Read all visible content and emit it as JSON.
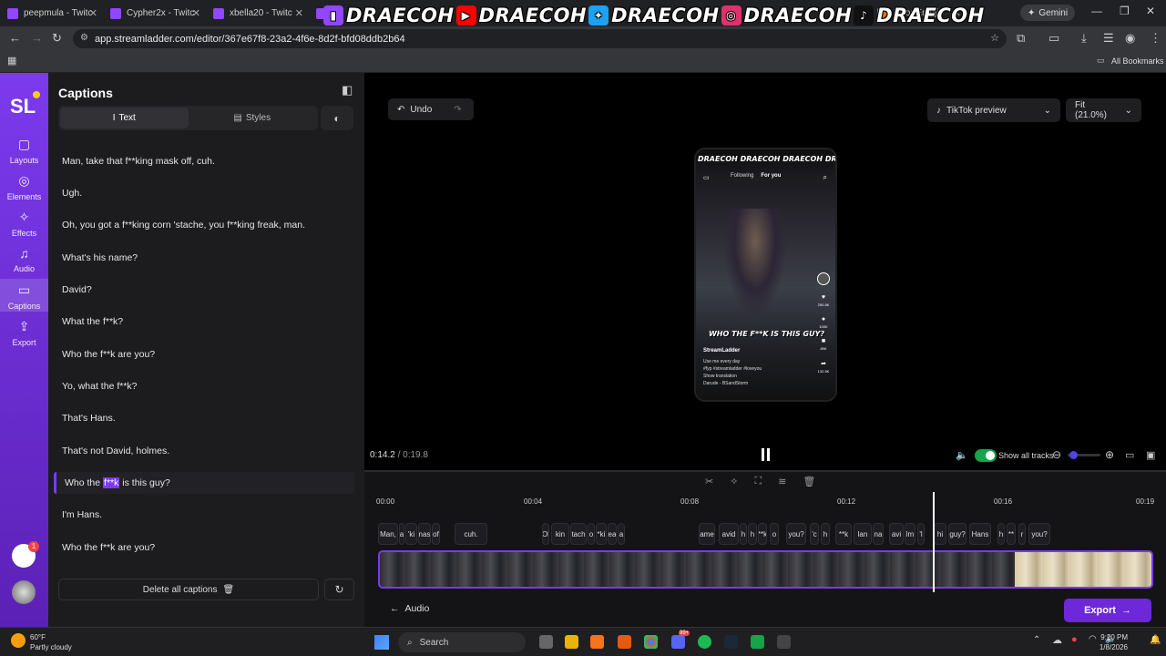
{
  "browser": {
    "tabs": [
      {
        "label": "peepmula - Twitc",
        "color": "#9146ff"
      },
      {
        "label": "Cypher2x - Twitc",
        "color": "#9146ff"
      },
      {
        "label": "xbella20 - Twitc",
        "color": "#9146ff"
      },
      {
        "label": "m",
        "color": "#9146ff"
      },
      {
        "label": "Door Emoji",
        "color": "#e8710a"
      }
    ],
    "url": "app.streamladder.com/editor/367e67f8-23a2-4f6e-8d2f-bfd08ddb2b64",
    "gemini": "Gemini",
    "bookmarks": "All Bookmarks"
  },
  "overlay_banner": {
    "items": [
      {
        "icon": "twitch-icon",
        "text": "DRAECOH",
        "color": "#9146ff"
      },
      {
        "icon": "youtube-icon",
        "text": "DRAECOH",
        "color": "#ff0000"
      },
      {
        "icon": "twitter-icon",
        "text": "DRAECOH",
        "color": "#1da1f2"
      },
      {
        "icon": "instagram-icon",
        "text": "DRAECOH",
        "color": "#e1306c"
      },
      {
        "icon": "tiktok-icon",
        "text": "DRAECOH",
        "color": "#000000"
      }
    ]
  },
  "rail": {
    "logo": "SL",
    "items": [
      {
        "label": "Layouts",
        "icon": "layouts-icon"
      },
      {
        "label": "Elements",
        "icon": "elements-icon"
      },
      {
        "label": "Effects",
        "icon": "effects-icon"
      },
      {
        "label": "Audio",
        "icon": "audio-icon"
      },
      {
        "label": "Captions",
        "icon": "captions-icon",
        "active": true
      },
      {
        "label": "Export",
        "icon": "export-icon"
      }
    ],
    "notification_count": "1"
  },
  "panel": {
    "title": "Captions",
    "tab_text": "Text",
    "tab_styles": "Styles",
    "captions": [
      "Man, take that f**king mask off, cuh.",
      "Ugh.",
      "Oh, you got a f**king corn 'stache, you f**king freak, man.",
      "What's his name?",
      "David?",
      "What the f**k?",
      "Who the f**k are you?",
      "Yo, what the f**k?",
      "That's Hans.",
      "That's not David, holmes.",
      "Who the f**k is this guy?",
      "I'm Hans.",
      "Who the f**k are you?"
    ],
    "active_caption_pre": "Who the",
    "active_caption_hl": "f**k",
    "active_caption_post": "is this guy?",
    "delete_all": "Delete all captions"
  },
  "editor": {
    "undo": "Undo",
    "preview_select": "TikTok preview",
    "fit_select": "Fit (21.0%)",
    "current_time": "0:14.2",
    "separator": "/",
    "total_time": "0:19.8",
    "show_all_tracks": "Show all tracks"
  },
  "phone": {
    "banner": "DRAECOH DRAECOH DRAECOH DRAECOH",
    "tab_following": "Following",
    "tab_for_you": "For you",
    "caption": "WHO THE F**K IS THIS GUY?",
    "username": "StreamLadder",
    "desc1": "Use me every day",
    "desc2": "#fyp #streamladder #loveyou",
    "desc3": "Show translation",
    "desc4": "Darude - BSandStorm",
    "likes": "250.5K",
    "comments": "100K",
    "saves": "89K",
    "shares": "132.5K"
  },
  "timeline": {
    "ticks": [
      "00:00",
      "00:04",
      "00:08",
      "00:12",
      "00:16",
      "00:19"
    ],
    "clips": [
      {
        "text": "Man,"
      },
      {
        "text": "a"
      },
      {
        "text": "'ki"
      },
      {
        "text": "nas"
      },
      {
        "text": "of"
      },
      {
        "text": "cuh."
      },
      {
        "text": "Ol"
      },
      {
        "text": "kin"
      },
      {
        "text": "tach"
      },
      {
        "text": "o"
      },
      {
        "text": "*ki"
      },
      {
        "text": "ea"
      },
      {
        "text": "a"
      },
      {
        "text": "ame"
      },
      {
        "text": "avid"
      },
      {
        "text": "h"
      },
      {
        "text": "h"
      },
      {
        "text": "**k"
      },
      {
        "text": "o"
      },
      {
        "text": "you?"
      },
      {
        "text": "'c"
      },
      {
        "text": "h"
      },
      {
        "text": "**k"
      },
      {
        "text": "lan"
      },
      {
        "text": "na"
      },
      {
        "text": "avi"
      },
      {
        "text": "lm"
      },
      {
        "text": "'l"
      },
      {
        "text": "hi"
      },
      {
        "text": "guy?"
      },
      {
        "text": "Hans"
      },
      {
        "text": "h"
      },
      {
        "text": "**"
      },
      {
        "text": "r"
      },
      {
        "text": "you?"
      }
    ],
    "audio": "Audio",
    "export": "Export"
  },
  "taskbar": {
    "temp": "60°F",
    "weather": "Partly cloudy",
    "search": "Search",
    "time": "9:20 PM",
    "date": "1/8/2026",
    "badge": "99+"
  }
}
